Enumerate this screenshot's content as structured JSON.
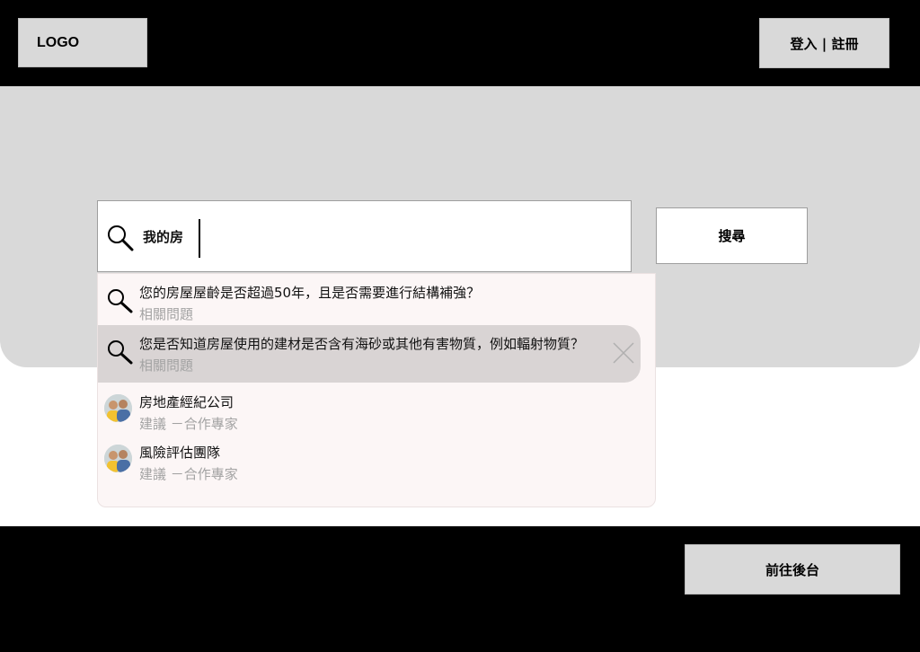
{
  "header": {
    "logo_label": "LOGO",
    "auth_label": "登入 | 註冊"
  },
  "search": {
    "query": "我的房",
    "button_label": "搜尋"
  },
  "suggestions": [
    {
      "text": "您的房屋屋齡是否超過50年，且是否需要進行結構補強？",
      "subtitle": "相關問題",
      "icon": "search-icon"
    },
    {
      "text": "您是否知道房屋使用的建材是否含有海砂或其他有害物質，例如輻射物質？",
      "subtitle": "相關問題",
      "icon": "search-icon",
      "highlighted": true
    }
  ],
  "experts": [
    {
      "name": "房地產經紀公司",
      "subtitle": "建議 －合作專家",
      "icon": "avatar"
    },
    {
      "name": "風險評估團隊",
      "subtitle": "建議 －合作專家",
      "icon": "avatar"
    }
  ],
  "footer": {
    "backend_label": "前往後台"
  },
  "colors": {
    "header_bg": "#000000",
    "hero_bg": "#d9d9d9",
    "dropdown_bg": "#fcf6f6",
    "highlight_bg": "#d9d4d4",
    "subtitle_text": "#a3a3a3"
  }
}
